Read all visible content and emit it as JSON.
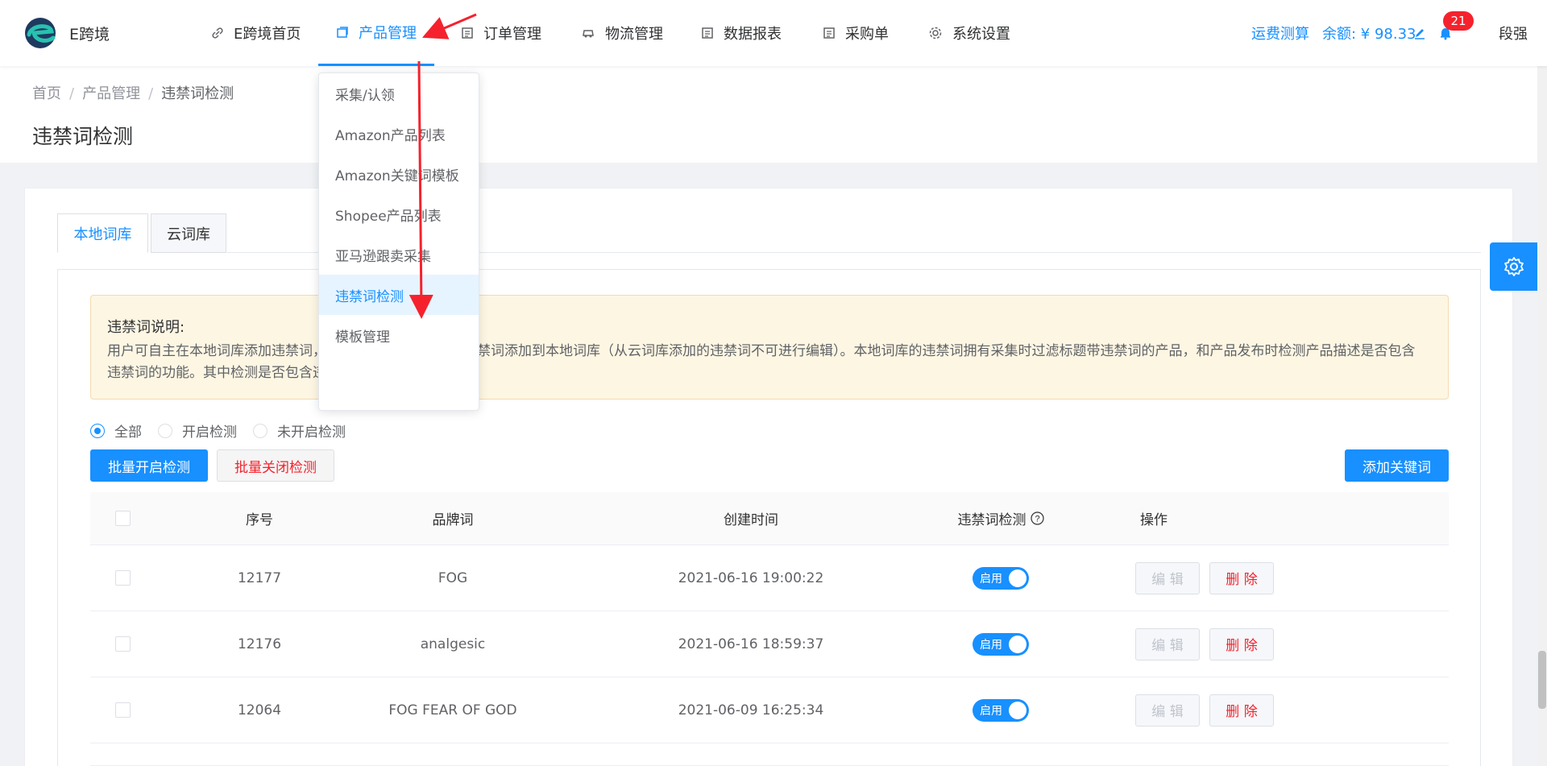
{
  "app": {
    "brand": "E跨境"
  },
  "nav": {
    "items": [
      {
        "label": "E跨境首页",
        "icon": "link-icon"
      },
      {
        "label": "产品管理",
        "icon": "product-icon"
      },
      {
        "label": "订单管理",
        "icon": "order-icon"
      },
      {
        "label": "物流管理",
        "icon": "truck-icon"
      },
      {
        "label": "数据报表",
        "icon": "report-icon"
      },
      {
        "label": "采购单",
        "icon": "purchase-icon"
      },
      {
        "label": "系统设置",
        "icon": "gear-icon"
      }
    ],
    "active": "产品管理",
    "freight_calc": "运费测算",
    "balance": "余额: ¥ 98.33",
    "notification_count": "21",
    "user": "段强"
  },
  "dropdown": {
    "items": [
      "采集/认领",
      "Amazon产品列表",
      "Amazon关键词模板",
      "Shopee产品列表",
      "亚马逊跟卖采集",
      "违禁词检测",
      "模板管理"
    ],
    "active": "违禁词检测"
  },
  "breadcrumb": {
    "items": [
      "首页",
      "产品管理",
      "违禁词检测"
    ]
  },
  "page": {
    "title": "违禁词检测"
  },
  "tabs": {
    "local": "本地词库",
    "cloud": "云词库",
    "active": "本地词库"
  },
  "notice": {
    "title": "违禁词说明:",
    "text": "用户可自主在本地词库添加违禁词，也可以从云词库中选择违禁词添加到本地词库（从云词库添加的违禁词不可进行编辑）。本地词库的违禁词拥有采集时过滤标题带违禁词的产品，和产品发布时检测产品描述是否包含违禁词的功能。其中检测是否包含违禁词"
  },
  "filters": {
    "options": [
      "全部",
      "开启检测",
      "未开启检测"
    ],
    "selected": "全部"
  },
  "buttons": {
    "batch_enable": "批量开启检测",
    "batch_disable": "批量关闭检测",
    "add_keyword": "添加关键词"
  },
  "table": {
    "headers": {
      "id": "序号",
      "brand": "品牌词",
      "created": "创建时间",
      "detect": "违禁词检测",
      "ops": "操作"
    },
    "switch_label": "启用",
    "edit_label": "编 辑",
    "delete_label": "删 除",
    "rows": [
      {
        "id": "12177",
        "brand": "FOG",
        "created": "2021-06-16 19:00:22",
        "enabled": true
      },
      {
        "id": "12176",
        "brand": "analgesic",
        "created": "2021-06-16 18:59:37",
        "enabled": true
      },
      {
        "id": "12064",
        "brand": "FOG FEAR OF GOD",
        "created": "2021-06-09 16:25:34",
        "enabled": true
      }
    ]
  },
  "colors": {
    "primary": "#1890ff",
    "danger": "#f5222d",
    "notice_bg": "#fdf6e3",
    "annotation": "#f5222d"
  }
}
